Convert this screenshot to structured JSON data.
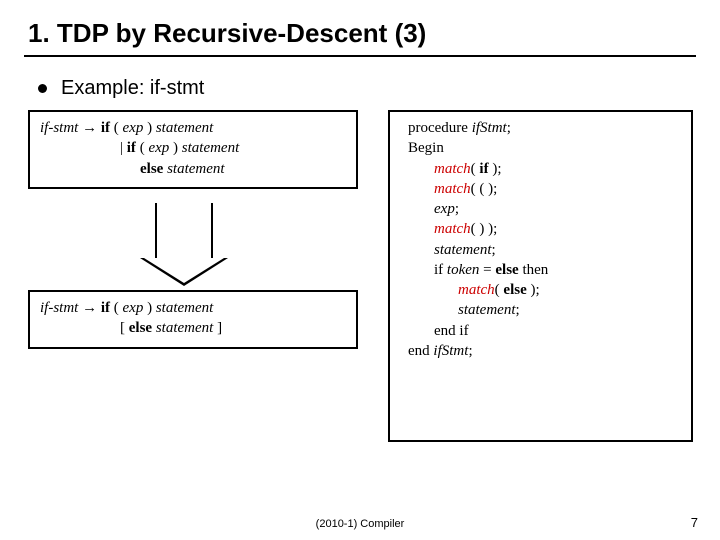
{
  "title": "1. TDP by Recursive-Descent (3)",
  "subtitle": "Example: if-stmt",
  "grammar1": {
    "l1a": "if-stmt",
    "l1b": " → ",
    "l1c": "if",
    "l1d": " ( ",
    "l1e": "exp",
    "l1f": " ) ",
    "l1g": "statement",
    "l2a": "| ",
    "l2b": "if",
    "l2c": " ( ",
    "l2d": "exp",
    "l2e": " ) ",
    "l2f": "statement",
    "l3a": "else",
    "l3b": " statement"
  },
  "grammar2": {
    "l1a": "if-stmt",
    "l1b": " → ",
    "l1c": "if",
    "l1d": " ( ",
    "l1e": "exp",
    "l1f": " ) ",
    "l1g": "statement",
    "l2a": "[ ",
    "l2b": "else",
    "l2c": " statement",
    "l2d": " ]"
  },
  "proc": {
    "l1a": "procedure ",
    "l1b": "ifStmt",
    "l1c": ";",
    "l2": "Begin",
    "l3a": "match",
    "l3b": "( ",
    "l3c": "if",
    "l3d": " );",
    "l4a": "match",
    "l4b": "( ( );",
    "l5a": "exp",
    "l5b": ";",
    "l6a": "match",
    "l6b": "( ) );",
    "l7a": "statement",
    "l7b": ";",
    "l8a": "if ",
    "l8b": "token",
    "l8c": " = ",
    "l8d": "else",
    "l8e": " then",
    "l9a": "match",
    "l9b": "( ",
    "l9c": "else",
    "l9d": " );",
    "l10a": "statement",
    "l10b": ";",
    "l11": "end if",
    "l12a": "end ",
    "l12b": "ifStmt",
    "l12c": ";"
  },
  "footer_center": "(2010-1) Compiler",
  "footer_right": "7"
}
